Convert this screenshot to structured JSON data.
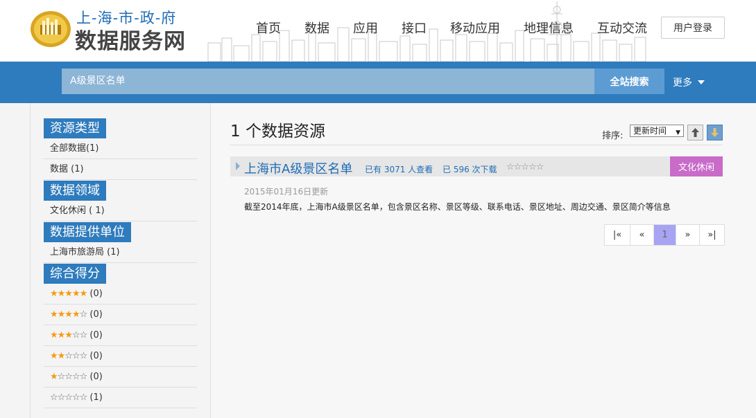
{
  "header": {
    "logo_top": "上-海-市-政-府",
    "logo_main": "数据服务网",
    "nav": [
      "首页",
      "数据",
      "应用",
      "接口",
      "移动应用",
      "地理信息",
      "互动交流"
    ],
    "login": "用户登录"
  },
  "search": {
    "value": "A级景区名单",
    "button": "全站搜索",
    "more": "更多"
  },
  "sidebar": {
    "groups": [
      {
        "title": "资源类型",
        "items": [
          "全部数据(1)",
          "数据 (1)"
        ]
      },
      {
        "title": "数据领域",
        "items": [
          "文化休闲 ( 1)"
        ]
      },
      {
        "title": "数据提供单位",
        "items": [
          "上海市旅游局 (1)"
        ]
      },
      {
        "title": "综合得分",
        "items": [
          {
            "filled": "★★★★★",
            "empty": "",
            "count": "(0)"
          },
          {
            "filled": "★★★★",
            "empty": "☆",
            "count": "(0)"
          },
          {
            "filled": "★★★",
            "empty": "☆☆",
            "count": "(0)"
          },
          {
            "filled": "★★",
            "empty": "☆☆☆",
            "count": "(0)"
          },
          {
            "filled": "★",
            "empty": "☆☆☆☆",
            "count": "(0)"
          },
          {
            "filled": "",
            "empty": "☆☆☆☆☆",
            "count": "(1)"
          }
        ]
      }
    ]
  },
  "results": {
    "title": "1 个数据资源",
    "sort_label": "排序:",
    "sort_value": "更新时间",
    "items": [
      {
        "title": "上海市A级景区名单",
        "views": "已有 3071 人查看",
        "downloads": "已 596 次下载",
        "stars": "☆☆☆☆☆",
        "tag": "文化休闲",
        "date": "2015年01月16日更新",
        "desc": "截至2014年底，上海市A级景区名单，包含景区名称、景区等级、联系电话、景区地址、周边交通、景区简介等信息"
      }
    ]
  },
  "pager": {
    "first": "|«",
    "prev": "«",
    "current": "1",
    "next": "»",
    "last": "»|"
  },
  "colors": {
    "primary": "#2e7bbd",
    "tag": "#c86bc9",
    "link": "#1f6cb5",
    "star": "#f39c12",
    "page_active": "#a7a4f3"
  }
}
